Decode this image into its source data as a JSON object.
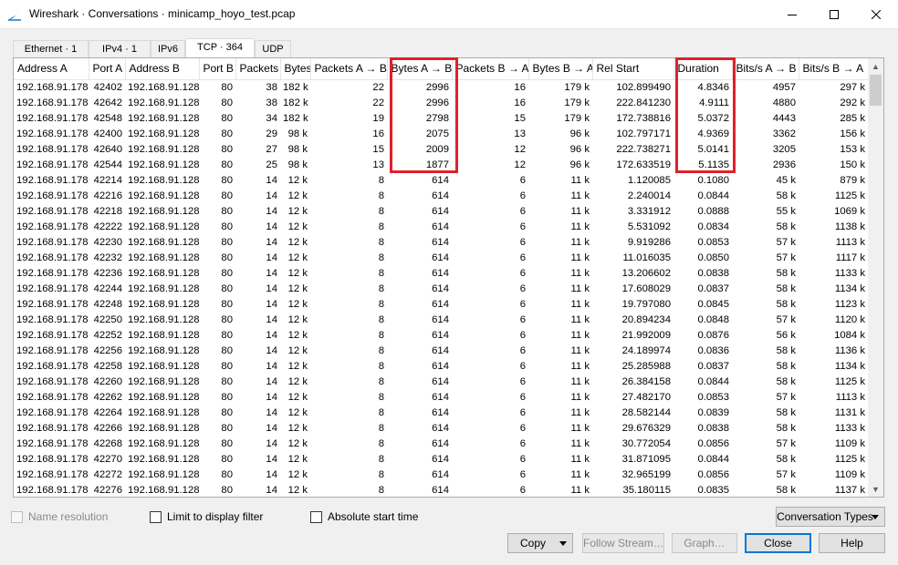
{
  "window": {
    "title": "Wireshark · Conversations · minicamp_hoyo_test.pcap",
    "min_icon": "minimize-icon",
    "max_icon": "maximize-icon",
    "close_icon": "close-icon"
  },
  "tabs": [
    {
      "label": "Ethernet · 1",
      "active": false
    },
    {
      "label": "IPv4 · 1",
      "active": false
    },
    {
      "label": "IPv6",
      "active": false
    },
    {
      "label": "TCP · 364",
      "active": true
    },
    {
      "label": "UDP",
      "active": false
    }
  ],
  "table": {
    "columns": [
      "Address A",
      "Port A",
      "Address B",
      "Port B",
      "Packets",
      "Bytes",
      "Packets A → B",
      "Bytes A → B",
      "Packets B → A",
      "Bytes B → A",
      "Rel Start",
      "Duration",
      "Bits/s A → B",
      "Bits/s B → A"
    ],
    "rows": [
      [
        "192.168.91.178",
        "42402",
        "192.168.91.128",
        "80",
        "38",
        "182 k",
        "22",
        "2996",
        "16",
        "179 k",
        "102.899490",
        "4.8346",
        "4957",
        "297 k"
      ],
      [
        "192.168.91.178",
        "42642",
        "192.168.91.128",
        "80",
        "38",
        "182 k",
        "22",
        "2996",
        "16",
        "179 k",
        "222.841230",
        "4.9111",
        "4880",
        "292 k"
      ],
      [
        "192.168.91.178",
        "42548",
        "192.168.91.128",
        "80",
        "34",
        "182 k",
        "19",
        "2798",
        "15",
        "179 k",
        "172.738816",
        "5.0372",
        "4443",
        "285 k"
      ],
      [
        "192.168.91.178",
        "42400",
        "192.168.91.128",
        "80",
        "29",
        "98 k",
        "16",
        "2075",
        "13",
        "96 k",
        "102.797171",
        "4.9369",
        "3362",
        "156 k"
      ],
      [
        "192.168.91.178",
        "42640",
        "192.168.91.128",
        "80",
        "27",
        "98 k",
        "15",
        "2009",
        "12",
        "96 k",
        "222.738271",
        "5.0141",
        "3205",
        "153 k"
      ],
      [
        "192.168.91.178",
        "42544",
        "192.168.91.128",
        "80",
        "25",
        "98 k",
        "13",
        "1877",
        "12",
        "96 k",
        "172.633519",
        "5.1135",
        "2936",
        "150 k"
      ],
      [
        "192.168.91.178",
        "42214",
        "192.168.91.128",
        "80",
        "14",
        "12 k",
        "8",
        "614",
        "6",
        "11 k",
        "1.120085",
        "0.1080",
        "45 k",
        "879 k"
      ],
      [
        "192.168.91.178",
        "42216",
        "192.168.91.128",
        "80",
        "14",
        "12 k",
        "8",
        "614",
        "6",
        "11 k",
        "2.240014",
        "0.0844",
        "58 k",
        "1125 k"
      ],
      [
        "192.168.91.178",
        "42218",
        "192.168.91.128",
        "80",
        "14",
        "12 k",
        "8",
        "614",
        "6",
        "11 k",
        "3.331912",
        "0.0888",
        "55 k",
        "1069 k"
      ],
      [
        "192.168.91.178",
        "42222",
        "192.168.91.128",
        "80",
        "14",
        "12 k",
        "8",
        "614",
        "6",
        "11 k",
        "5.531092",
        "0.0834",
        "58 k",
        "1138 k"
      ],
      [
        "192.168.91.178",
        "42230",
        "192.168.91.128",
        "80",
        "14",
        "12 k",
        "8",
        "614",
        "6",
        "11 k",
        "9.919286",
        "0.0853",
        "57 k",
        "1113 k"
      ],
      [
        "192.168.91.178",
        "42232",
        "192.168.91.128",
        "80",
        "14",
        "12 k",
        "8",
        "614",
        "6",
        "11 k",
        "11.016035",
        "0.0850",
        "57 k",
        "1117 k"
      ],
      [
        "192.168.91.178",
        "42236",
        "192.168.91.128",
        "80",
        "14",
        "12 k",
        "8",
        "614",
        "6",
        "11 k",
        "13.206602",
        "0.0838",
        "58 k",
        "1133 k"
      ],
      [
        "192.168.91.178",
        "42244",
        "192.168.91.128",
        "80",
        "14",
        "12 k",
        "8",
        "614",
        "6",
        "11 k",
        "17.608029",
        "0.0837",
        "58 k",
        "1134 k"
      ],
      [
        "192.168.91.178",
        "42248",
        "192.168.91.128",
        "80",
        "14",
        "12 k",
        "8",
        "614",
        "6",
        "11 k",
        "19.797080",
        "0.0845",
        "58 k",
        "1123 k"
      ],
      [
        "192.168.91.178",
        "42250",
        "192.168.91.128",
        "80",
        "14",
        "12 k",
        "8",
        "614",
        "6",
        "11 k",
        "20.894234",
        "0.0848",
        "57 k",
        "1120 k"
      ],
      [
        "192.168.91.178",
        "42252",
        "192.168.91.128",
        "80",
        "14",
        "12 k",
        "8",
        "614",
        "6",
        "11 k",
        "21.992009",
        "0.0876",
        "56 k",
        "1084 k"
      ],
      [
        "192.168.91.178",
        "42256",
        "192.168.91.128",
        "80",
        "14",
        "12 k",
        "8",
        "614",
        "6",
        "11 k",
        "24.189974",
        "0.0836",
        "58 k",
        "1136 k"
      ],
      [
        "192.168.91.178",
        "42258",
        "192.168.91.128",
        "80",
        "14",
        "12 k",
        "8",
        "614",
        "6",
        "11 k",
        "25.285988",
        "0.0837",
        "58 k",
        "1134 k"
      ],
      [
        "192.168.91.178",
        "42260",
        "192.168.91.128",
        "80",
        "14",
        "12 k",
        "8",
        "614",
        "6",
        "11 k",
        "26.384158",
        "0.0844",
        "58 k",
        "1125 k"
      ],
      [
        "192.168.91.178",
        "42262",
        "192.168.91.128",
        "80",
        "14",
        "12 k",
        "8",
        "614",
        "6",
        "11 k",
        "27.482170",
        "0.0853",
        "57 k",
        "1113 k"
      ],
      [
        "192.168.91.178",
        "42264",
        "192.168.91.128",
        "80",
        "14",
        "12 k",
        "8",
        "614",
        "6",
        "11 k",
        "28.582144",
        "0.0839",
        "58 k",
        "1131 k"
      ],
      [
        "192.168.91.178",
        "42266",
        "192.168.91.128",
        "80",
        "14",
        "12 k",
        "8",
        "614",
        "6",
        "11 k",
        "29.676329",
        "0.0838",
        "58 k",
        "1133 k"
      ],
      [
        "192.168.91.178",
        "42268",
        "192.168.91.128",
        "80",
        "14",
        "12 k",
        "8",
        "614",
        "6",
        "11 k",
        "30.772054",
        "0.0856",
        "57 k",
        "1109 k"
      ],
      [
        "192.168.91.178",
        "42270",
        "192.168.91.128",
        "80",
        "14",
        "12 k",
        "8",
        "614",
        "6",
        "11 k",
        "31.871095",
        "0.0844",
        "58 k",
        "1125 k"
      ],
      [
        "192.168.91.178",
        "42272",
        "192.168.91.128",
        "80",
        "14",
        "12 k",
        "8",
        "614",
        "6",
        "11 k",
        "32.965199",
        "0.0856",
        "57 k",
        "1109 k"
      ],
      [
        "192.168.91.178",
        "42276",
        "192.168.91.128",
        "80",
        "14",
        "12 k",
        "8",
        "614",
        "6",
        "11 k",
        "35.180115",
        "0.0835",
        "58 k",
        "1137 k"
      ]
    ]
  },
  "options": {
    "name_resolution": "Name resolution",
    "limit_filter": "Limit to display filter",
    "absolute_start": "Absolute start time"
  },
  "buttons": {
    "conversation_types": "Conversation Types",
    "copy": "Copy",
    "follow_stream": "Follow Stream…",
    "graph": "Graph…",
    "close": "Close",
    "help": "Help"
  },
  "colors": {
    "highlight": "#e0202a",
    "accent": "#0078d7"
  }
}
